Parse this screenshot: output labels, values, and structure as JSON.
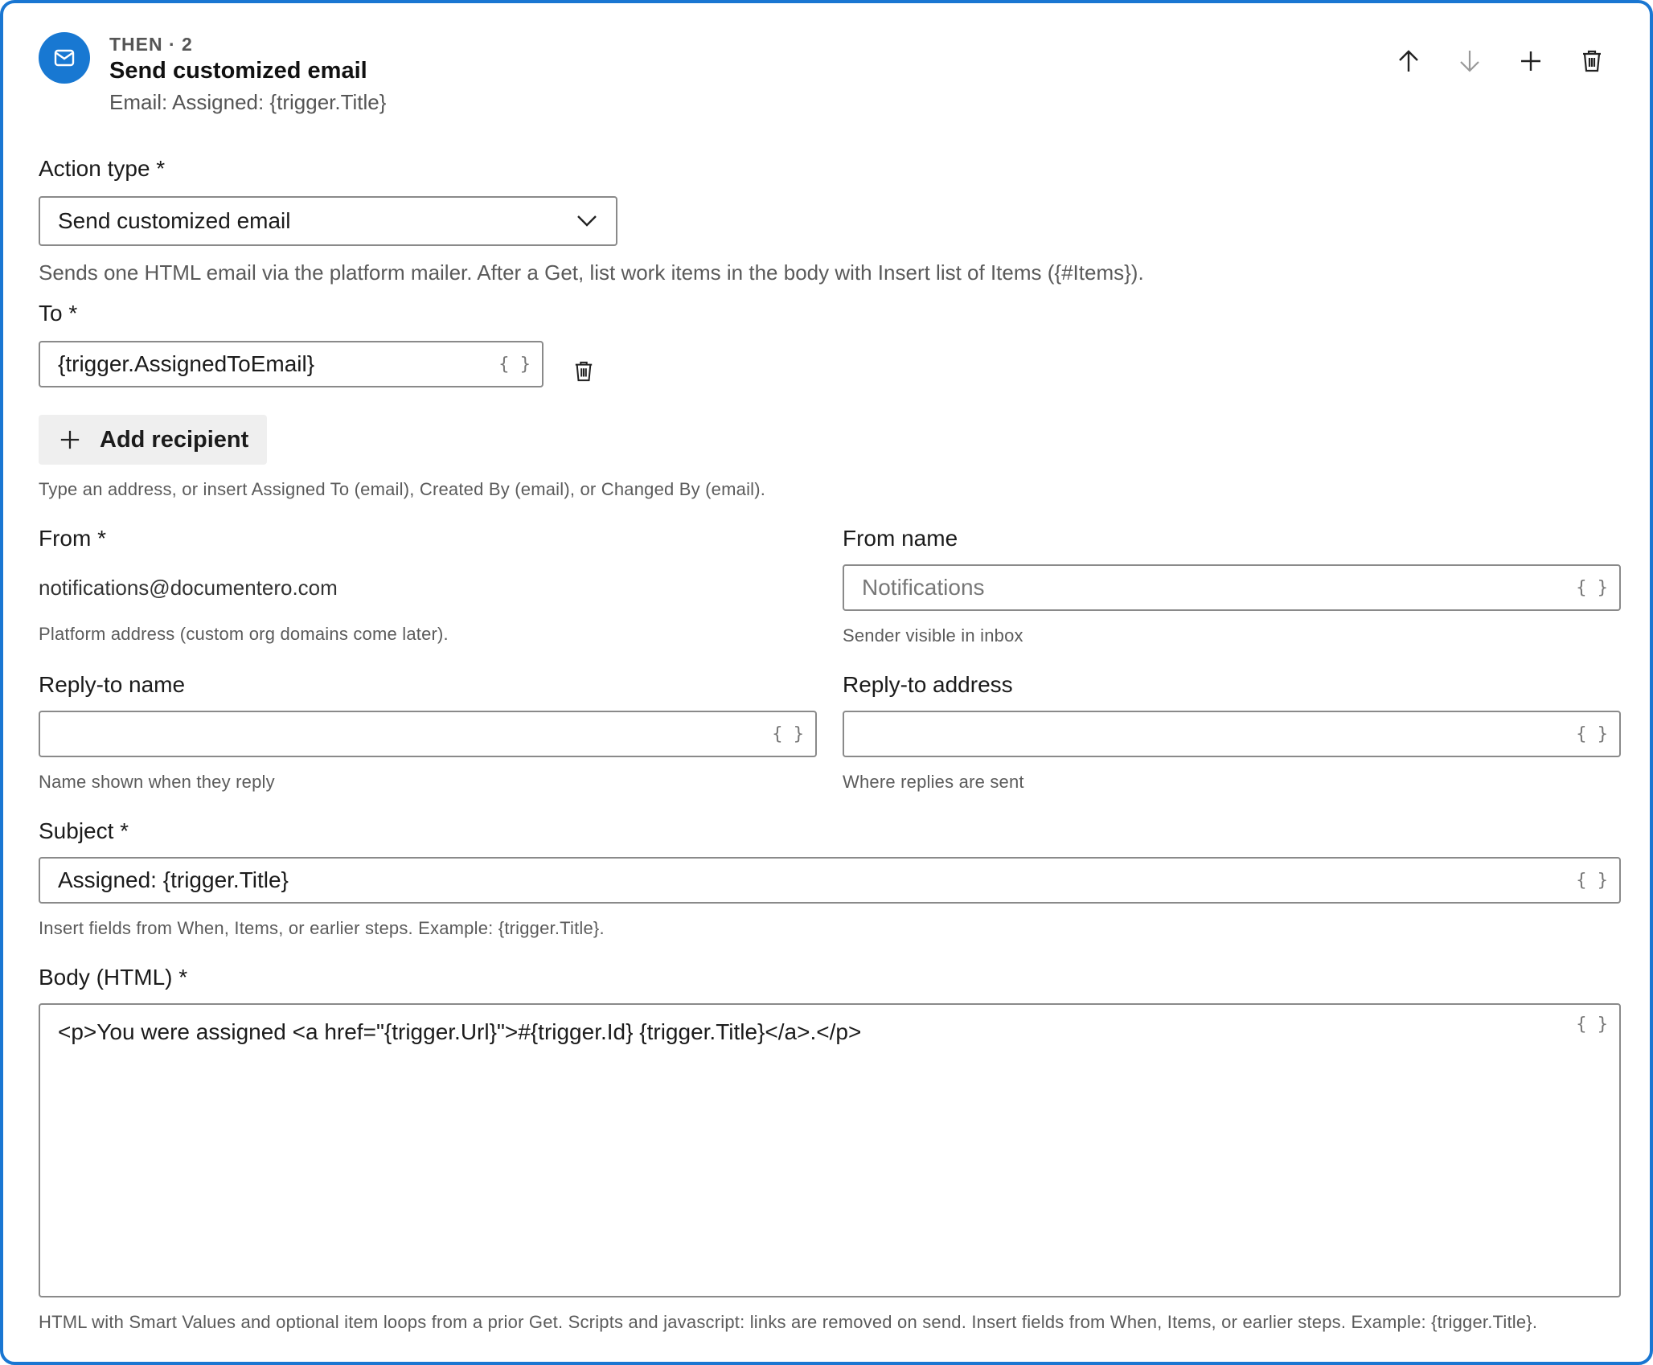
{
  "header": {
    "eyebrow": "THEN · 2",
    "title": "Send customized email",
    "subtitle": "Email: Assigned: {trigger.Title}",
    "avatar_icon": "envelope-icon",
    "accent_color": "#1878d2"
  },
  "toolbar": {
    "icons": [
      "arrow-up-icon",
      "arrow-down-icon",
      "plus-icon",
      "trash-icon"
    ]
  },
  "action_type": {
    "label": "Action type *",
    "value": "Send customized email",
    "description": "Sends one HTML email via the platform mailer. After a Get, list work items in the body with Insert list of Items ({#Items})."
  },
  "to": {
    "label": "To *",
    "value": "{trigger.AssignedToEmail}",
    "add_recipient_label": "Add recipient",
    "help": "Type an address, or insert Assigned To (email), Created By (email), or Changed By (email)."
  },
  "from": {
    "label": "From *",
    "value": "notifications@documentero.com",
    "help": "Platform address (custom org domains come later)."
  },
  "from_name": {
    "label": "From name",
    "placeholder": "Notifications",
    "help": "Sender visible in inbox"
  },
  "reply_to_name": {
    "label": "Reply-to name",
    "value": "",
    "help": "Name shown when they reply"
  },
  "reply_to_address": {
    "label": "Reply-to address",
    "value": "",
    "help": "Where replies are sent"
  },
  "subject": {
    "label": "Subject *",
    "value": "Assigned: {trigger.Title}",
    "help": "Insert fields from When, Items, or earlier steps. Example: {trigger.Title}."
  },
  "body": {
    "label": "Body (HTML) *",
    "value": "<p>You were assigned <a href=\"{trigger.Url}\">#{trigger.Id} {trigger.Title}</a>.</p>",
    "help": "HTML with Smart Values and optional item loops from a prior Get. Scripts and javascript: links are removed on send. Insert fields from When, Items, or earlier steps. Example: {trigger.Title}."
  },
  "smart_value_glyph": "{ }"
}
